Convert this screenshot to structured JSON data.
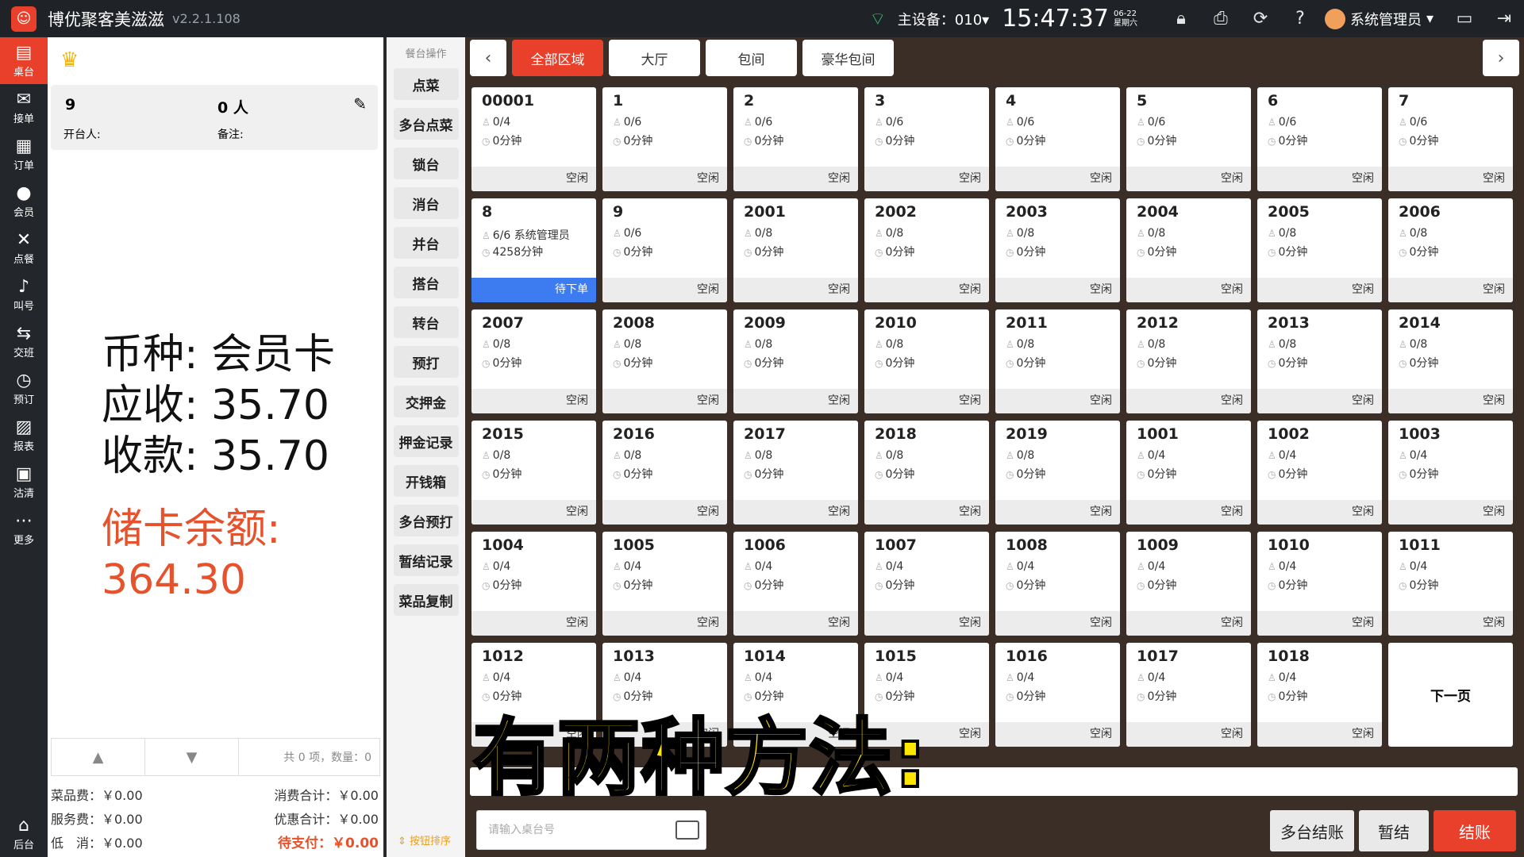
{
  "app": {
    "title": "博优聚客美滋滋",
    "version": "v2.2.1.108"
  },
  "topbar": {
    "device": "主设备：010▾",
    "time": "15:47:37",
    "date": "06-22",
    "weekday": "星期六",
    "user": "系统管理员"
  },
  "sidenav": [
    {
      "label": "桌台",
      "icon": "table-icon"
    },
    {
      "label": "接单",
      "icon": "order-receive-icon"
    },
    {
      "label": "订单",
      "icon": "order-list-icon"
    },
    {
      "label": "会员",
      "icon": "member-icon"
    },
    {
      "label": "点餐",
      "icon": "dining-icon"
    },
    {
      "label": "叫号",
      "icon": "bell-icon"
    },
    {
      "label": "交班",
      "icon": "shift-icon"
    },
    {
      "label": "预订",
      "icon": "clock-icon"
    },
    {
      "label": "报表",
      "icon": "report-icon"
    },
    {
      "label": "沽清",
      "icon": "soldout-icon"
    },
    {
      "label": "更多",
      "icon": "more-icon"
    }
  ],
  "sidenav_bottom": {
    "label": "后台",
    "icon": "backend-icon"
  },
  "current_table": {
    "name": "9",
    "people": "0 人",
    "opener": "开台人:",
    "note": "备注:"
  },
  "payment": {
    "currency": "币种: 会员卡",
    "receivable": "应收: 35.70",
    "received": "收款: 35.70",
    "balance_label": "储卡余额:",
    "balance": "364.30"
  },
  "pager": {
    "info": "共 0 项，数量：0"
  },
  "summary": {
    "dish_fee": "菜品费：￥0.00",
    "service_fee": "服务费：￥0.00",
    "min_fee": "低　消：￥0.00",
    "consume_total": "消费合计：￥0.00",
    "discount_total": "优惠合计：￥0.00",
    "pending": "待支付：￥0.00"
  },
  "ops": {
    "header": "餐台操作",
    "buttons": [
      "点菜",
      "多台点菜",
      "锁台",
      "消台",
      "并台",
      "搭台",
      "转台",
      "预打",
      "交押金",
      "押金记录",
      "开钱箱",
      "多台预打",
      "暂结记录",
      "菜品复制"
    ],
    "sort": "⇕ 按钮排序"
  },
  "tabs": [
    "全部区域",
    "大厅",
    "包间",
    "豪华包间"
  ],
  "tables": [
    {
      "no": "00001",
      "seat": "0/4",
      "min": "0分钟",
      "status": "空闲"
    },
    {
      "no": "1",
      "seat": "0/6",
      "min": "0分钟",
      "status": "空闲"
    },
    {
      "no": "2",
      "seat": "0/6",
      "min": "0分钟",
      "status": "空闲"
    },
    {
      "no": "3",
      "seat": "0/6",
      "min": "0分钟",
      "status": "空闲"
    },
    {
      "no": "4",
      "seat": "0/6",
      "min": "0分钟",
      "status": "空闲"
    },
    {
      "no": "5",
      "seat": "0/6",
      "min": "0分钟",
      "status": "空闲"
    },
    {
      "no": "6",
      "seat": "0/6",
      "min": "0分钟",
      "status": "空闲"
    },
    {
      "no": "7",
      "seat": "0/6",
      "min": "0分钟",
      "status": "空闲"
    },
    {
      "no": "8",
      "seat": "6/6 系统管理员",
      "min": "4258分钟",
      "status": "待下单",
      "busy": true
    },
    {
      "no": "9",
      "seat": "0/6",
      "min": "0分钟",
      "status": "空闲"
    },
    {
      "no": "2001",
      "seat": "0/8",
      "min": "0分钟",
      "status": "空闲"
    },
    {
      "no": "2002",
      "seat": "0/8",
      "min": "0分钟",
      "status": "空闲"
    },
    {
      "no": "2003",
      "seat": "0/8",
      "min": "0分钟",
      "status": "空闲"
    },
    {
      "no": "2004",
      "seat": "0/8",
      "min": "0分钟",
      "status": "空闲"
    },
    {
      "no": "2005",
      "seat": "0/8",
      "min": "0分钟",
      "status": "空闲"
    },
    {
      "no": "2006",
      "seat": "0/8",
      "min": "0分钟",
      "status": "空闲"
    },
    {
      "no": "2007",
      "seat": "0/8",
      "min": "0分钟",
      "status": "空闲"
    },
    {
      "no": "2008",
      "seat": "0/8",
      "min": "0分钟",
      "status": "空闲"
    },
    {
      "no": "2009",
      "seat": "0/8",
      "min": "0分钟",
      "status": "空闲"
    },
    {
      "no": "2010",
      "seat": "0/8",
      "min": "0分钟",
      "status": "空闲"
    },
    {
      "no": "2011",
      "seat": "0/8",
      "min": "0分钟",
      "status": "空闲"
    },
    {
      "no": "2012",
      "seat": "0/8",
      "min": "0分钟",
      "status": "空闲"
    },
    {
      "no": "2013",
      "seat": "0/8",
      "min": "0分钟",
      "status": "空闲"
    },
    {
      "no": "2014",
      "seat": "0/8",
      "min": "0分钟",
      "status": "空闲"
    },
    {
      "no": "2015",
      "seat": "0/8",
      "min": "0分钟",
      "status": "空闲"
    },
    {
      "no": "2016",
      "seat": "0/8",
      "min": "0分钟",
      "status": "空闲"
    },
    {
      "no": "2017",
      "seat": "0/8",
      "min": "0分钟",
      "status": "空闲"
    },
    {
      "no": "2018",
      "seat": "0/8",
      "min": "0分钟",
      "status": "空闲"
    },
    {
      "no": "2019",
      "seat": "0/8",
      "min": "0分钟",
      "status": "空闲"
    },
    {
      "no": "1001",
      "seat": "0/4",
      "min": "0分钟",
      "status": "空闲"
    },
    {
      "no": "1002",
      "seat": "0/4",
      "min": "0分钟",
      "status": "空闲"
    },
    {
      "no": "1003",
      "seat": "0/4",
      "min": "0分钟",
      "status": "空闲"
    },
    {
      "no": "1004",
      "seat": "0/4",
      "min": "0分钟",
      "status": "空闲"
    },
    {
      "no": "1005",
      "seat": "0/4",
      "min": "0分钟",
      "status": "空闲"
    },
    {
      "no": "1006",
      "seat": "0/4",
      "min": "0分钟",
      "status": "空闲"
    },
    {
      "no": "1007",
      "seat": "0/4",
      "min": "0分钟",
      "status": "空闲"
    },
    {
      "no": "1008",
      "seat": "0/4",
      "min": "0分钟",
      "status": "空闲"
    },
    {
      "no": "1009",
      "seat": "0/4",
      "min": "0分钟",
      "status": "空闲"
    },
    {
      "no": "1010",
      "seat": "0/4",
      "min": "0分钟",
      "status": "空闲"
    },
    {
      "no": "1011",
      "seat": "0/4",
      "min": "0分钟",
      "status": "空闲"
    },
    {
      "no": "1012",
      "seat": "0/4",
      "min": "0分钟",
      "status": "空闲"
    },
    {
      "no": "1013",
      "seat": "0/4",
      "min": "0分钟",
      "status": "空闲"
    },
    {
      "no": "1014",
      "seat": "0/4",
      "min": "0分钟",
      "status": "空闲"
    },
    {
      "no": "1015",
      "seat": "0/4",
      "min": "0分钟",
      "status": "空闲"
    },
    {
      "no": "1016",
      "seat": "0/4",
      "min": "0分钟",
      "status": "空闲"
    },
    {
      "no": "1017",
      "seat": "0/4",
      "min": "0分钟",
      "status": "空闲"
    },
    {
      "no": "1018",
      "seat": "0/4",
      "min": "0分钟",
      "status": "空闲"
    }
  ],
  "next_page": "下一页",
  "search": {
    "placeholder": "请输入桌台号"
  },
  "actions": {
    "multi_checkout": "多台结账",
    "temp": "暂结",
    "checkout": "结账"
  },
  "caption": "有两种方法:",
  "colors": {
    "accent": "#e8402a",
    "busy": "#3d7cf0",
    "balance": "#e5522c"
  }
}
